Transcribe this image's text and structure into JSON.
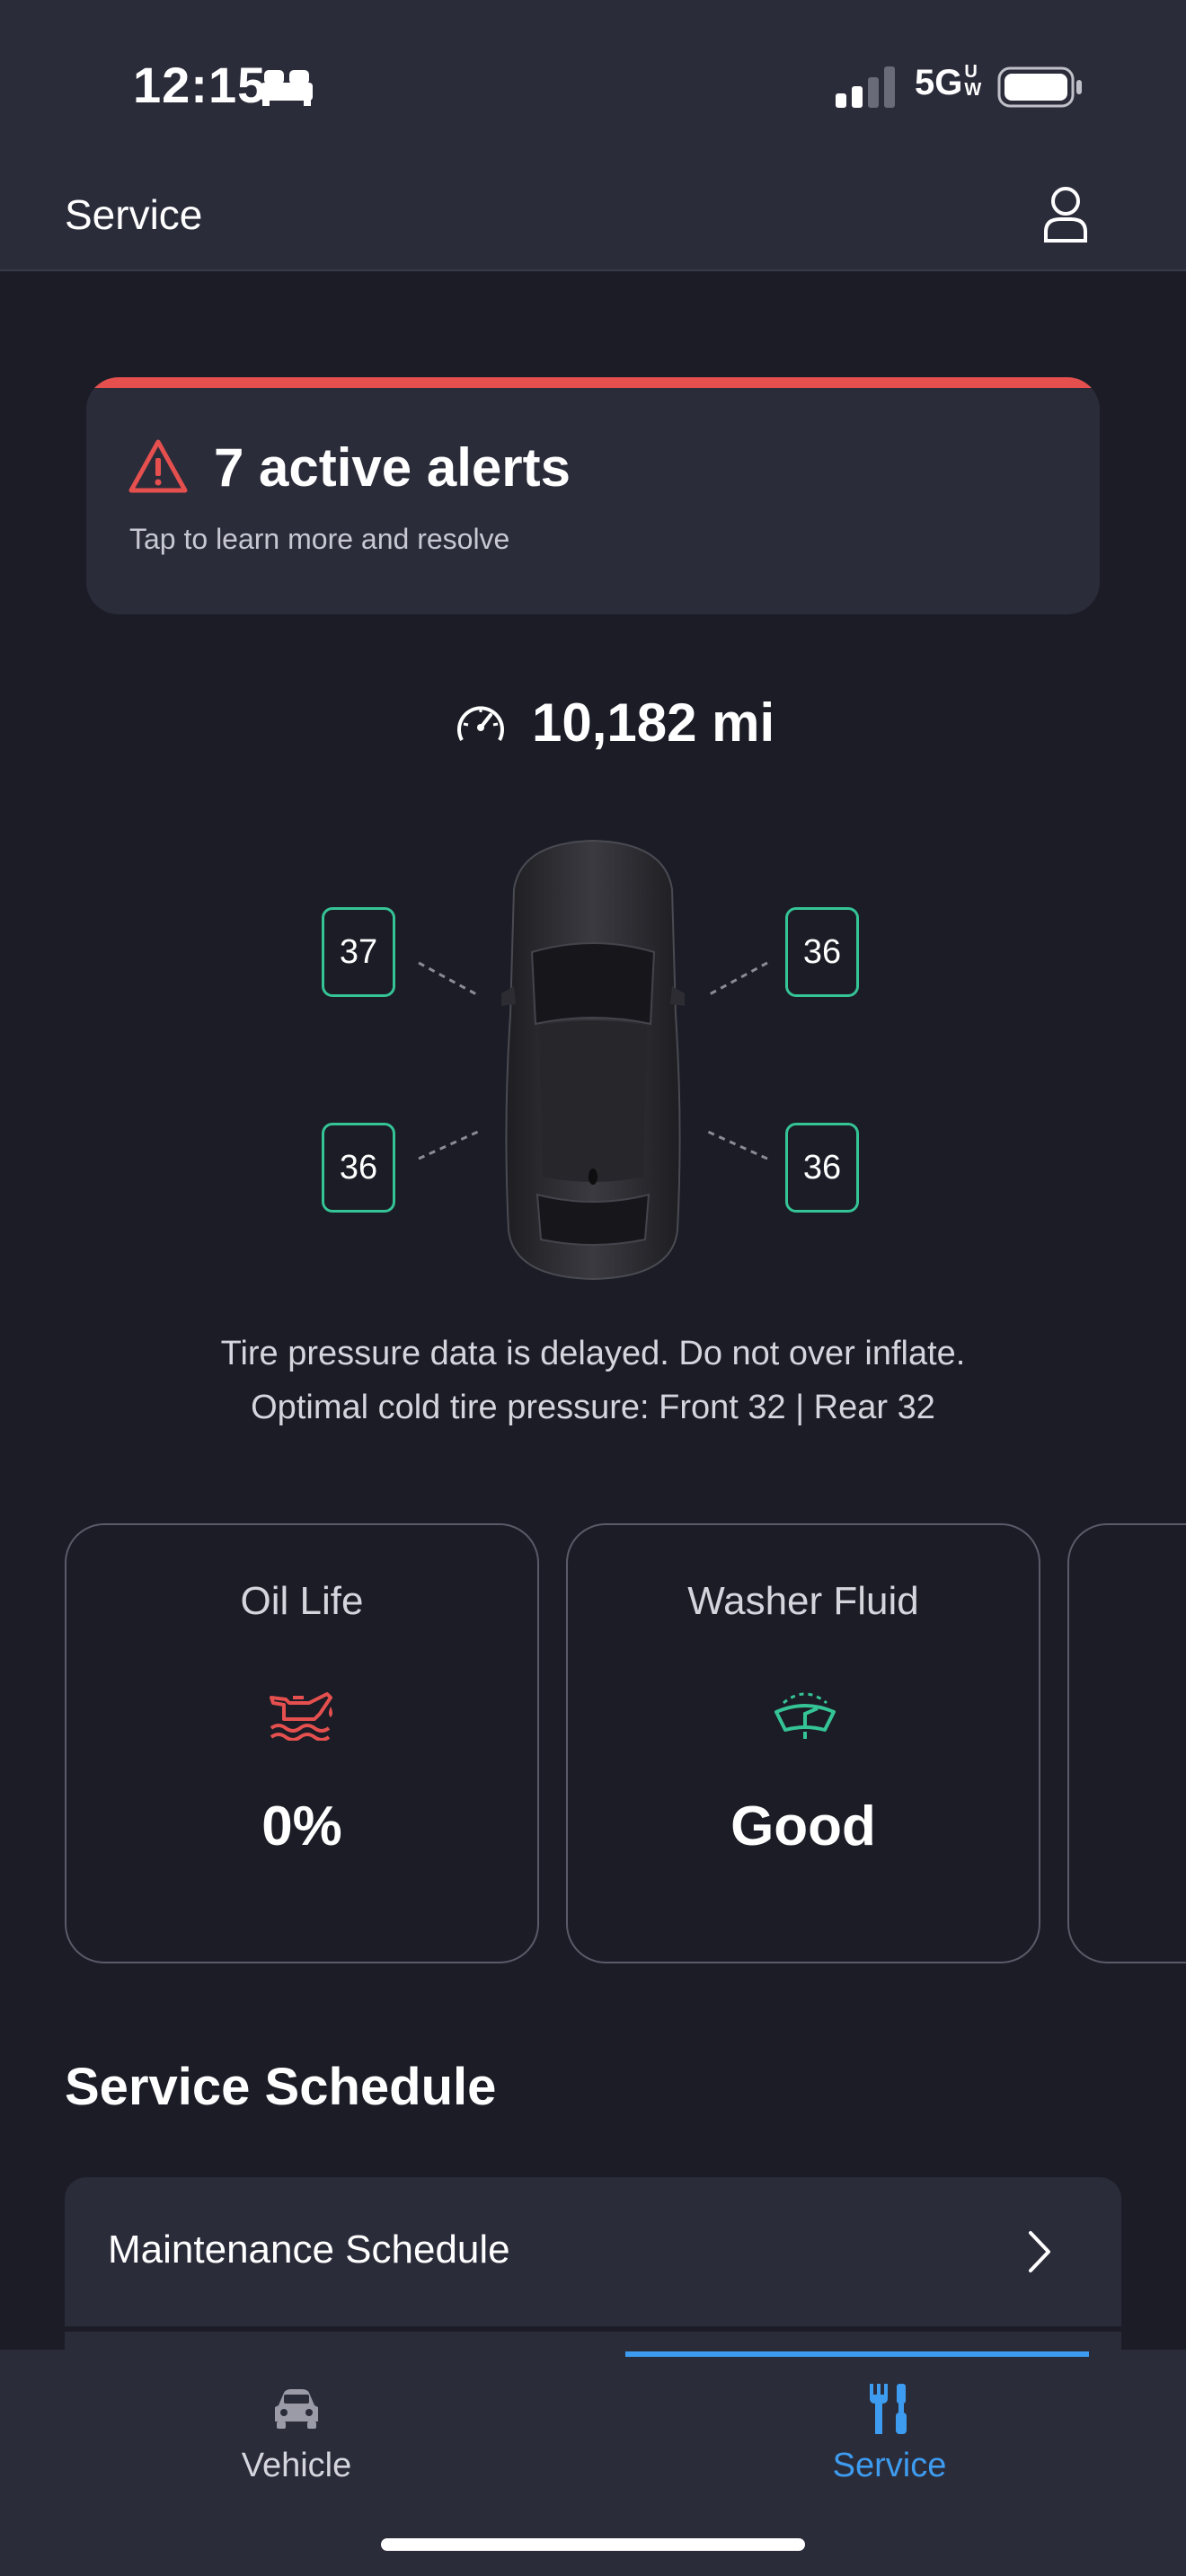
{
  "status_bar": {
    "time": "12:15",
    "network": "5G",
    "network_suffix": "UW",
    "icons": [
      "bed-icon",
      "signal-icon",
      "battery-icon"
    ]
  },
  "header": {
    "title": "Service",
    "icons": [
      "profile-icon"
    ]
  },
  "alert": {
    "title": "7 active alerts",
    "subtitle": "Tap to learn more and resolve",
    "color": "#e5504f",
    "icon": "warning-icon"
  },
  "odometer": {
    "value": "10,182 mi",
    "icon": "speedometer-icon"
  },
  "tires": {
    "front_left": "37",
    "front_right": "36",
    "rear_left": "36",
    "rear_right": "36",
    "ok_color": "#35c496"
  },
  "tire_note": {
    "line1": "Tire pressure data is delayed. Do not over inflate.",
    "line2": "Optimal cold tire pressure: Front 32 | Rear 32"
  },
  "cards": [
    {
      "label": "Oil Life",
      "value": "0%",
      "icon": "oil-can-icon",
      "icon_color": "#e5504f"
    },
    {
      "label": "Washer Fluid",
      "value": "Good",
      "icon": "washer-fluid-icon",
      "icon_color": "#35c496"
    }
  ],
  "service_schedule": {
    "title": "Service Schedule",
    "rows": [
      {
        "label": "Maintenance Schedule"
      }
    ]
  },
  "tab_bar": {
    "tabs": [
      {
        "label": "Vehicle",
        "icon": "car-icon",
        "active": false
      },
      {
        "label": "Service",
        "icon": "tools-icon",
        "active": true
      }
    ],
    "active_color": "#3d9cf0"
  }
}
